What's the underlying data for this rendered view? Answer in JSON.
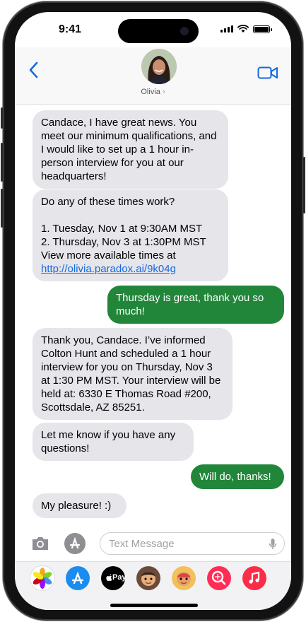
{
  "status": {
    "time": "9:41"
  },
  "header": {
    "contact_name": "Olivia",
    "chevron": "›"
  },
  "messages": [
    {
      "direction": "in",
      "text": "Candace, I have great news. You meet our minimum qualifications, and I would like to set up a 1 hour in-person interview for you at our headquarters!"
    },
    {
      "direction": "in",
      "text": "Do any of these times work?\n\n1. Tuesday, Nov 1 at 9:30AM MST\n2. Thursday, Nov 3 at 1:30PM MST\nView more available times at ",
      "link": "http://olivia.paradox.ai/9k04g"
    },
    {
      "direction": "out",
      "text": "Thursday is great, thank you so much!"
    },
    {
      "direction": "in",
      "text": "Thank you, Candace. I’ve informed Colton Hunt and scheduled a 1 hour interview for you on Thursday, Nov 3 at 1:30 PM MST. Your interview will be held at: 6330 E Thomas Road #200, Scottsdale, AZ 85251."
    },
    {
      "direction": "in",
      "text": "Let me know if you have any questions!"
    },
    {
      "direction": "out",
      "text": "Will do, thanks!"
    },
    {
      "direction": "in",
      "text": "My pleasure! :)"
    }
  ],
  "input": {
    "placeholder": "Text Message"
  },
  "icons": {
    "back": "chevron-left-icon",
    "video": "video-camera-icon",
    "camera": "camera-icon",
    "apps": "app-store-icon",
    "mic": "microphone-icon"
  },
  "dock_apps": [
    "photos-icon",
    "app-store-icon",
    "apple-pay-icon",
    "memoji-icon",
    "memoji-stickers-icon",
    "web-images-icon",
    "music-icon"
  ],
  "dock": {
    "applepay_label": "Pay"
  },
  "colors": {
    "outgoing_bubble": "#22863a",
    "incoming_bubble": "#e5e5ea",
    "accent": "#1769e0"
  }
}
